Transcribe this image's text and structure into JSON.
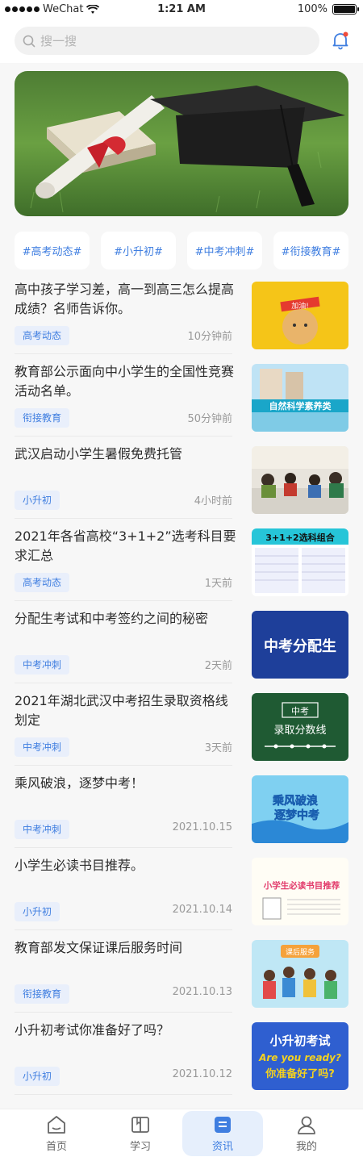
{
  "status_bar": {
    "carrier": "WeChat",
    "time": "1:21 AM",
    "battery": "100%"
  },
  "search": {
    "placeholder": "搜一搜"
  },
  "tags": [
    "#高考动态#",
    "#小升初#",
    "#中考冲刺#",
    "#衔接教育#"
  ],
  "news": [
    {
      "title": "高中孩子学习差，高一到高三怎么提高成绩？名师告诉你。",
      "tag": "高考动态",
      "time": "10分钟前",
      "thumb_text": "加油!"
    },
    {
      "title": "教育部公示面向中小学生的全国性竞赛活动名单。",
      "tag": "衔接教育",
      "time": "50分钟前",
      "thumb_text": "自然科学素养类"
    },
    {
      "title": "武汉启动小学生暑假免费托管",
      "tag": "小升初",
      "time": "4小时前",
      "thumb_text": ""
    },
    {
      "title": "2021年各省高校“3+1+2”选考科目要求汇总",
      "tag": "高考动态",
      "time": "1天前",
      "thumb_text": "3+1+2选科组合"
    },
    {
      "title": "分配生考试和中考签约之间的秘密",
      "tag": "中考冲刺",
      "time": "2天前",
      "thumb_text": "中考分配生"
    },
    {
      "title": "2021年湖北武汉中考招生录取资格线划定",
      "tag": "中考冲刺",
      "time": "3天前",
      "thumb_text": "录取分数线"
    },
    {
      "title": "乘风破浪，逐梦中考！",
      "tag": "中考冲刺",
      "time": "2021.10.15",
      "thumb_text": "乘风破浪 逐梦中考"
    },
    {
      "title": "小学生必读书目推荐。",
      "tag": "小升初",
      "time": "2021.10.14",
      "thumb_text": "小学生必读书目推荐"
    },
    {
      "title": "教育部发文保证课后服务时间",
      "tag": "衔接教育",
      "time": "2021.10.13",
      "thumb_text": "课后服务"
    },
    {
      "title": "小升初考试你准备好了吗？",
      "tag": "小升初",
      "time": "2021.10.12",
      "thumb_text": "小升初考试 Are you ready? 你准备好了吗?"
    }
  ],
  "tabbar": [
    {
      "label": "首页",
      "icon": "home-icon"
    },
    {
      "label": "学习",
      "icon": "book-icon"
    },
    {
      "label": "资讯",
      "icon": "news-icon",
      "active": true
    },
    {
      "label": "我的",
      "icon": "profile-icon"
    }
  ],
  "colors": {
    "accent": "#3f7ee0",
    "tag_bg": "#e9effb",
    "active_tab_bg": "#e6effc"
  }
}
